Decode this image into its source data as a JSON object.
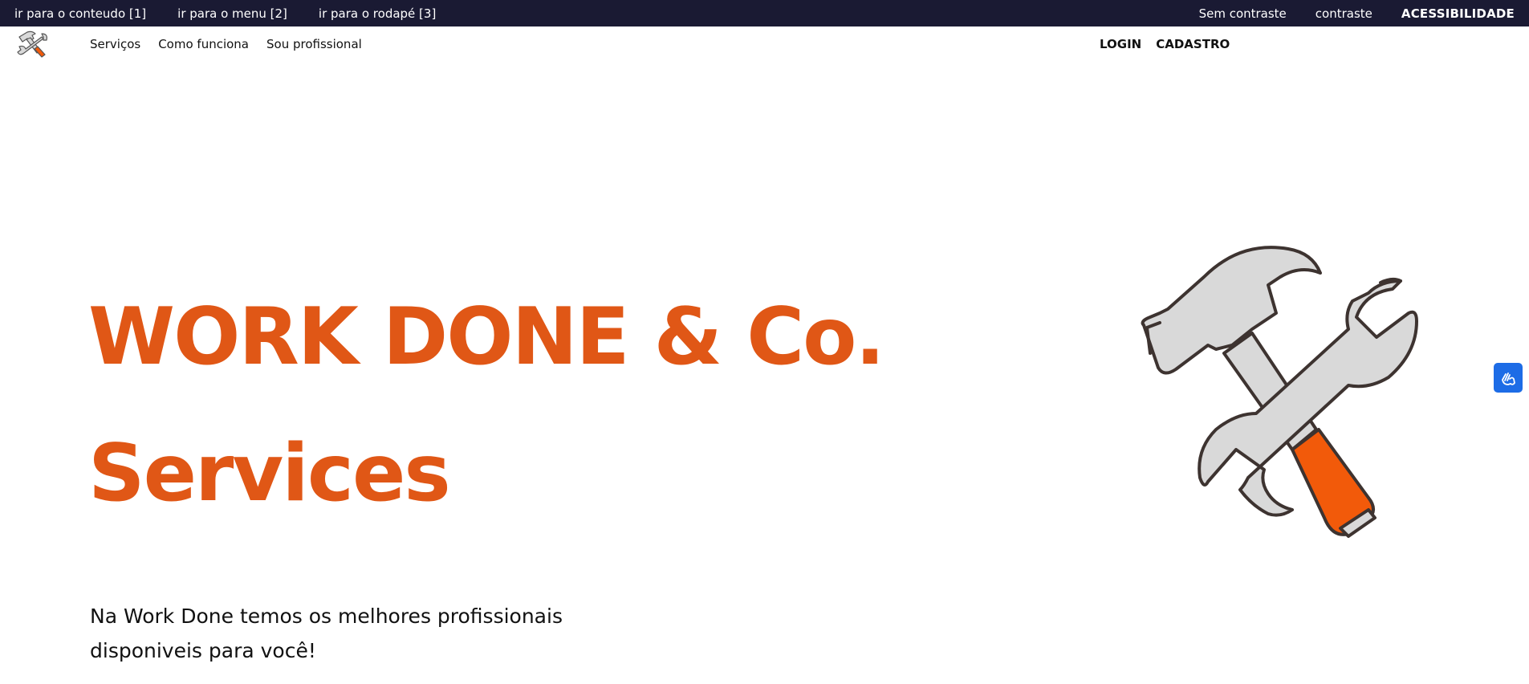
{
  "topbar": {
    "skip_links": [
      {
        "label": "ir para o conteudo [1]"
      },
      {
        "label": "ir para o menu [2]"
      },
      {
        "label": "ir para o rodapé [3]"
      }
    ],
    "no_contrast_label": "Sem contraste",
    "contrast_label": "contraste",
    "accessibility_label": "ACESSIBILIDADE",
    "background_color": "#1a1a33"
  },
  "nav": {
    "logo_icon": "hammer-wrench-icon",
    "links": [
      {
        "label": "Serviços"
      },
      {
        "label": "Como funciona"
      },
      {
        "label": "Sou profissional"
      }
    ],
    "login_label": "LOGIN",
    "signup_label": "CADASTRO"
  },
  "hero": {
    "title_line1": "WORK DONE & Co.",
    "title_line2": "Services",
    "subtitle": "Na Work Done temos os melhores profissionais disponiveis para você!",
    "illustration_icon": "hammer-wrench-icon",
    "accent_color": "#e05716"
  },
  "widgets": {
    "libras_icon": "sign-language-hands-icon",
    "libras_color": "#1d6ce6"
  }
}
